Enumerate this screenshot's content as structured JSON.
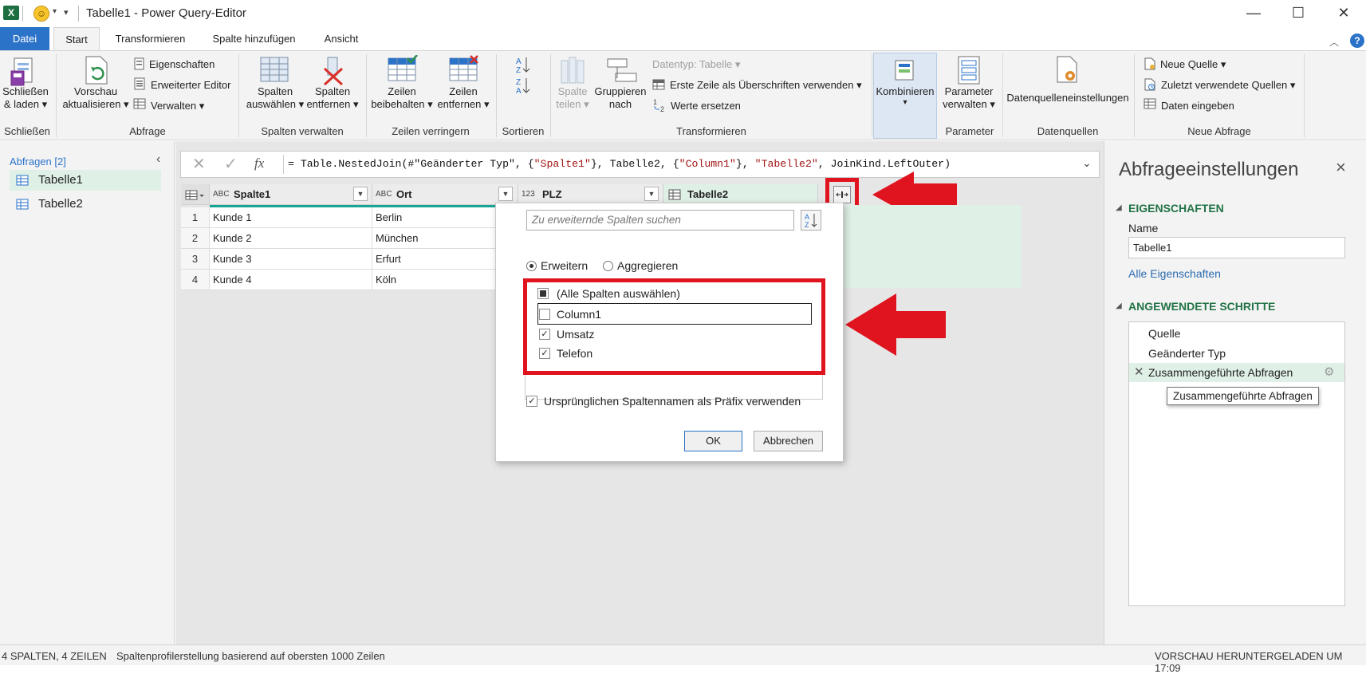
{
  "window": {
    "title": "Tabelle1 - Power Query-Editor",
    "minimize": "—",
    "maximize": "☐",
    "close": "✕",
    "excel_letter": "X",
    "qat_dropdown": "▾",
    "qat_customize": "▾"
  },
  "tabs": [
    "Datei",
    "Start",
    "Transformieren",
    "Spalte hinzufügen",
    "Ansicht"
  ],
  "ribbon": {
    "close_load": [
      "Schließen",
      "& laden ▾"
    ],
    "preview_refresh": [
      "Vorschau",
      "aktualisieren ▾"
    ],
    "properties": "Eigenschaften",
    "advanced_editor": "Erweiterter Editor",
    "manage": "Verwalten ▾",
    "choose_columns": [
      "Spalten",
      "auswählen ▾"
    ],
    "remove_columns": [
      "Spalten",
      "entfernen ▾"
    ],
    "keep_rows": [
      "Zeilen",
      "beibehalten ▾"
    ],
    "remove_rows": [
      "Zeilen",
      "entfernen ▾"
    ],
    "split_column": [
      "Spalte",
      "teilen ▾"
    ],
    "group_by": [
      "Gruppieren",
      "nach"
    ],
    "data_type": "Datentyp: Tabelle ▾",
    "first_row_headers": "Erste Zeile als Überschriften verwenden ▾",
    "replace_values": "Werte ersetzen",
    "combine": [
      "Kombinieren",
      "▾"
    ],
    "manage_parameters": [
      "Parameter",
      "verwalten ▾"
    ],
    "data_source_settings": "Datenquelleneinstellungen",
    "new_source": "Neue Quelle ▾",
    "recent_sources": "Zuletzt verwendete Quellen ▾",
    "enter_data": "Daten eingeben",
    "groups": [
      "Schließen",
      "Abfrage",
      "Spalten verwalten",
      "Zeilen verringern",
      "Sortieren",
      "Transformieren",
      "Parameter",
      "Datenquellen",
      "Neue Abfrage"
    ]
  },
  "queries": {
    "header": "Abfragen [2]",
    "items": [
      "Tabelle1",
      "Tabelle2"
    ]
  },
  "formula": {
    "prefix": "= Table.NestedJoin(#\"Geänderter Typ\", {",
    "s1": "\"Spalte1\"",
    "mid1": "}, Tabelle2, {",
    "s2": "\"Column1\"",
    "mid2": "}, ",
    "s3": "\"Tabelle2\"",
    "suffix": ", JoinKind.LeftOuter)",
    "fx": "fx"
  },
  "grid": {
    "headers": [
      "Spalte1",
      "Ort",
      "PLZ",
      "Tabelle2"
    ],
    "type_labels": [
      "ABC",
      "ABC",
      "123",
      ""
    ],
    "rows": [
      [
        "1",
        "Kunde 1",
        "Berlin"
      ],
      [
        "2",
        "Kunde 2",
        "München"
      ],
      [
        "3",
        "Kunde 3",
        "Erfurt"
      ],
      [
        "4",
        "Kunde 4",
        "Köln"
      ]
    ]
  },
  "expand_dialog": {
    "search_placeholder": "Zu erweiternde Spalten suchen",
    "mode_expand": "Erweitern",
    "mode_aggregate": "Aggregieren",
    "select_all": "(Alle Spalten auswählen)",
    "columns": [
      {
        "name": "Column1",
        "checked": false
      },
      {
        "name": "Umsatz",
        "checked": true
      },
      {
        "name": "Telefon",
        "checked": true
      }
    ],
    "prefix_option": "Ursprünglichen Spaltennamen als Präfix verwenden",
    "ok": "OK",
    "cancel": "Abbrechen"
  },
  "settings": {
    "title": "Abfrageeinstellungen",
    "properties_header": "EIGENSCHAFTEN",
    "name_label": "Name",
    "name_value": "Tabelle1",
    "all_properties": "Alle Eigenschaften",
    "steps_header": "ANGEWENDETE SCHRITTE",
    "steps": [
      "Quelle",
      "Geänderter Typ",
      "Zusammengeführte Abfragen"
    ],
    "tooltip": "Zusammengeführte Abfragen"
  },
  "status": {
    "left": "4 SPALTEN, 4 ZEILEN",
    "profiling": "Spaltenprofilerstellung basierend auf obersten 1000 Zeilen",
    "right": "VORSCHAU HERUNTERGELADEN UM 17:09"
  },
  "colors": {
    "accent": "#2b73c9",
    "highlight_red": "#e0141e",
    "selected_green": "#dff0e6",
    "teal_quality": "#17a596"
  }
}
